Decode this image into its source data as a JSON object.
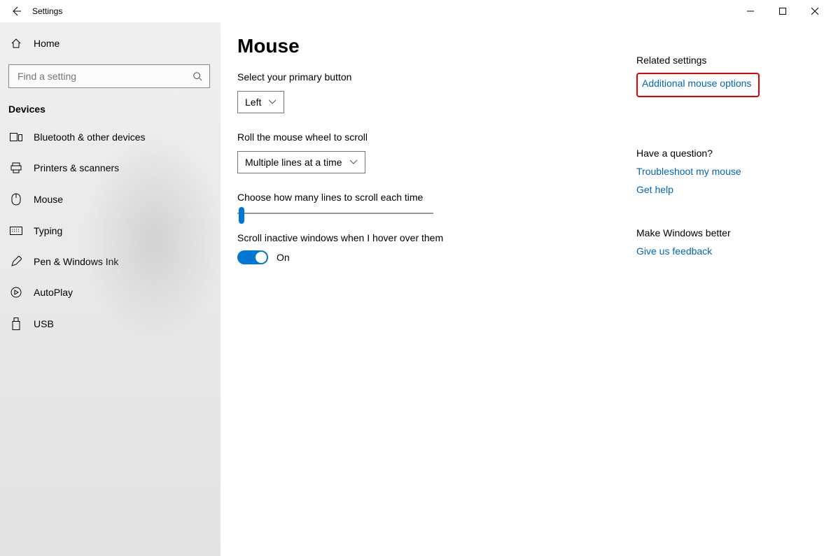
{
  "window": {
    "title": "Settings"
  },
  "sidebar": {
    "home_label": "Home",
    "search_placeholder": "Find a setting",
    "section_label": "Devices",
    "items": [
      {
        "label": "Bluetooth & other devices"
      },
      {
        "label": "Printers & scanners"
      },
      {
        "label": "Mouse"
      },
      {
        "label": "Typing"
      },
      {
        "label": "Pen & Windows Ink"
      },
      {
        "label": "AutoPlay"
      },
      {
        "label": "USB"
      }
    ]
  },
  "page": {
    "title": "Mouse",
    "primary_button_label": "Select your primary button",
    "primary_button_value": "Left",
    "wheel_label": "Roll the mouse wheel to scroll",
    "wheel_value": "Multiple lines at a time",
    "lines_label": "Choose how many lines to scroll each time",
    "inactive_label": "Scroll inactive windows when I hover over them",
    "toggle_state": "On"
  },
  "right": {
    "related_heading": "Related settings",
    "additional_mouse": "Additional mouse options",
    "question_heading": "Have a question?",
    "troubleshoot": "Troubleshoot my mouse",
    "get_help": "Get help",
    "improve_heading": "Make Windows better",
    "feedback": "Give us feedback"
  }
}
